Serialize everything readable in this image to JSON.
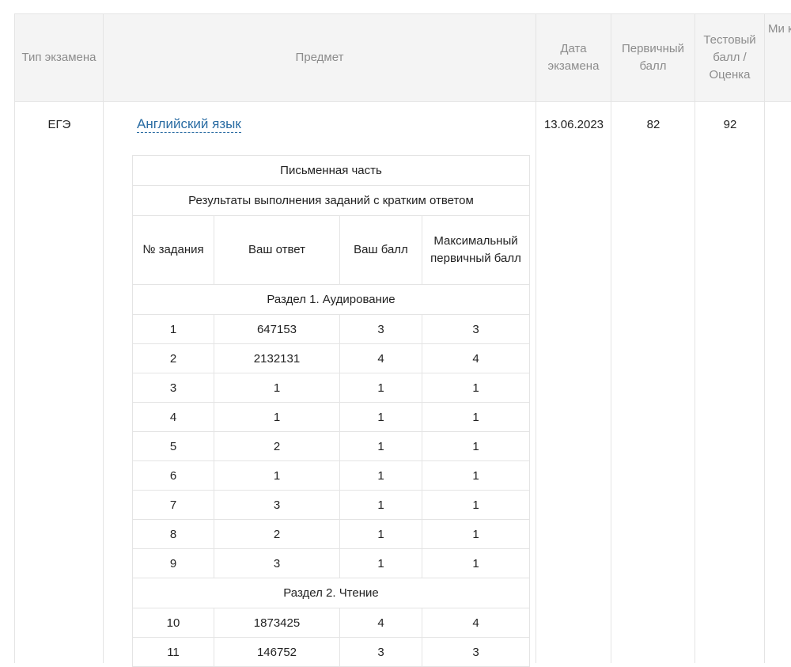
{
  "headers": {
    "exam_type": "Тип экзамена",
    "subject": "Предмет",
    "exam_date": "Дата экзамена",
    "primary_score": "Первичный балл",
    "test_score": "Тестовый балл / Оценка",
    "min_partial": "Ми ко т"
  },
  "exam": {
    "type": "ЕГЭ",
    "subject": "Английский язык",
    "date": "13.06.2023",
    "primary_score": "82",
    "test_score": "92"
  },
  "details": {
    "part_title": "Письменная часть",
    "section_title": "Результаты выполнения заданий с кратким ответом",
    "columns": [
      "№ задания",
      "Ваш ответ",
      "Ваш балл",
      "Максимальный первичный балл"
    ],
    "sections": [
      {
        "name": "Раздел 1. Аудирование",
        "rows": [
          [
            "1",
            "647153",
            "3",
            "3"
          ],
          [
            "2",
            "2132131",
            "4",
            "4"
          ],
          [
            "3",
            "1",
            "1",
            "1"
          ],
          [
            "4",
            "1",
            "1",
            "1"
          ],
          [
            "5",
            "2",
            "1",
            "1"
          ],
          [
            "6",
            "1",
            "1",
            "1"
          ],
          [
            "7",
            "3",
            "1",
            "1"
          ],
          [
            "8",
            "2",
            "1",
            "1"
          ],
          [
            "9",
            "3",
            "1",
            "1"
          ]
        ]
      },
      {
        "name": "Раздел 2. Чтение",
        "rows": [
          [
            "10",
            "1873425",
            "4",
            "4"
          ],
          [
            "11",
            "146752",
            "3",
            "3"
          ]
        ]
      }
    ]
  }
}
